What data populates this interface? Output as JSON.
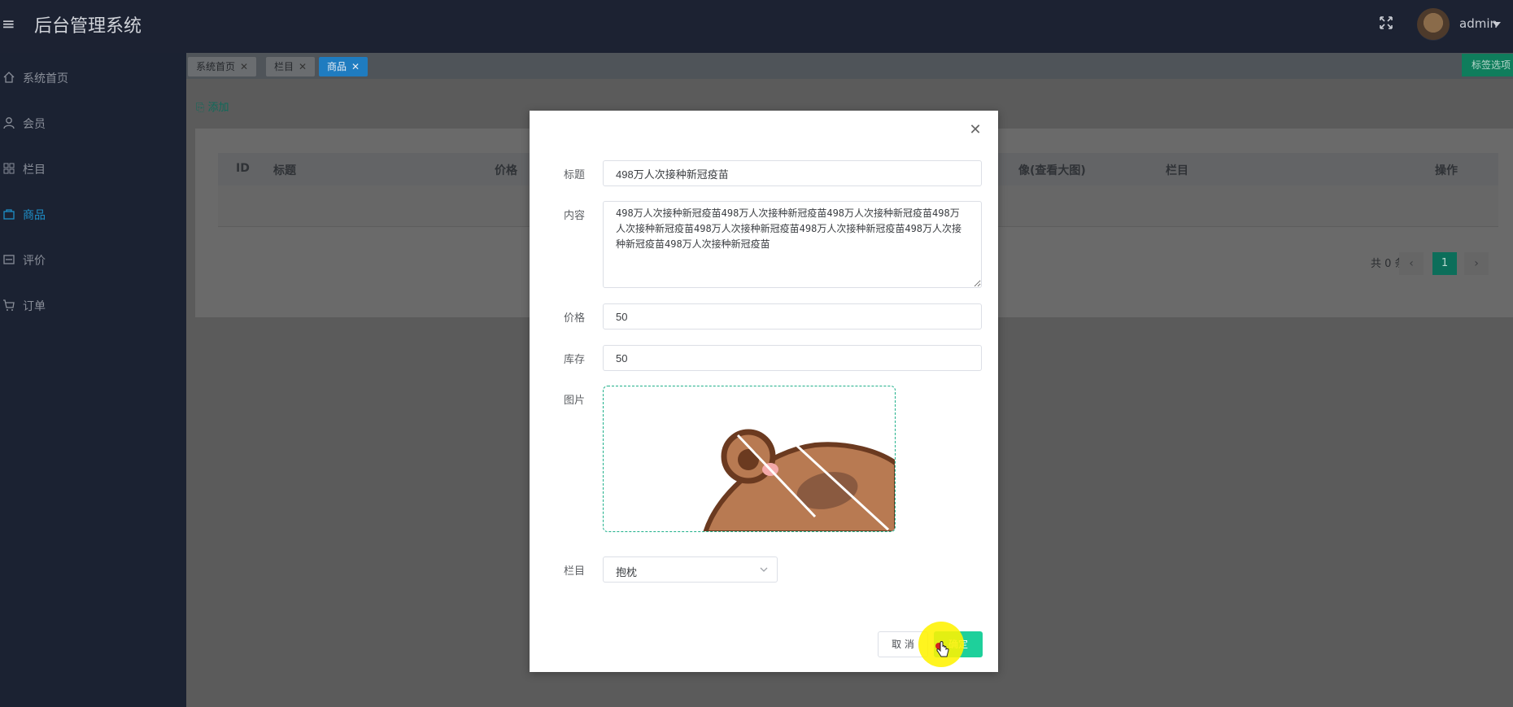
{
  "header": {
    "title": "后台管理系统",
    "user": "admin"
  },
  "sidebar": {
    "items": [
      {
        "label": "系统首页",
        "icon": "home-icon"
      },
      {
        "label": "会员",
        "icon": "user-icon"
      },
      {
        "label": "栏目",
        "icon": "grid-icon"
      },
      {
        "label": "商品",
        "icon": "bag-icon",
        "active": true
      },
      {
        "label": "评价",
        "icon": "comment-icon"
      },
      {
        "label": "订单",
        "icon": "cart-icon"
      }
    ]
  },
  "tabs": [
    {
      "label": "系统首页"
    },
    {
      "label": "栏目"
    },
    {
      "label": "商品",
      "active": true
    }
  ],
  "tab_options_label": "标签选项",
  "toolbar": {
    "add_label": "添加"
  },
  "table": {
    "columns": [
      "ID",
      "标题",
      "价格",
      "像(查看大图)",
      "栏目",
      "操作"
    ]
  },
  "pagination": {
    "total": "共 0 条",
    "prev": "‹",
    "page": "1",
    "next": "›"
  },
  "modal": {
    "fields": {
      "title_label": "标题",
      "title_value": "498万人次接种新冠疫苗",
      "content_label": "内容",
      "content_value": "498万人次接种新冠疫苗498万人次接种新冠疫苗498万人次接种新冠疫苗498万人次接种新冠疫苗498万人次接种新冠疫苗498万人次接种新冠疫苗498万人次接种新冠疫苗498万人次接种新冠疫苗",
      "price_label": "价格",
      "price_value": "50",
      "stock_label": "库存",
      "stock_value": "50",
      "image_label": "图片",
      "category_label": "栏目",
      "category_value": "抱枕"
    },
    "cancel_label": "取 消",
    "ok_label": "确定"
  },
  "colors": {
    "accent": "#1ed09b",
    "active_tab": "#1f7cc0",
    "sidebar": "#1b2232"
  }
}
